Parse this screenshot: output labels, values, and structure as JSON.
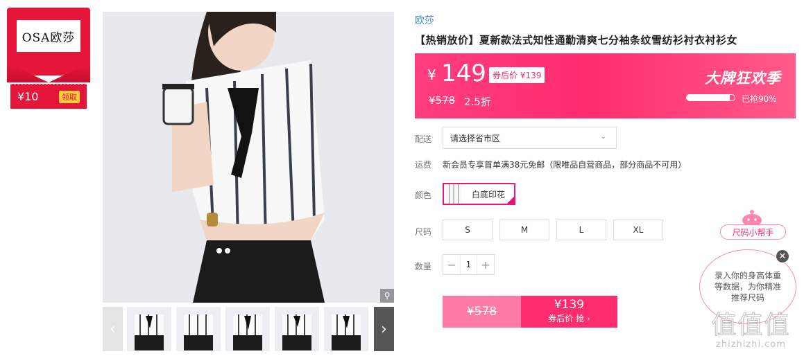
{
  "brand_card": {
    "logo_text": "OSA欧莎",
    "coupon_value": "¥10",
    "claim_label": "领取"
  },
  "product": {
    "brand": "欧莎",
    "title": "【热销放价】夏新款法式知性通勤清爽七分袖条纹雪纺衫衬衣衬衫女"
  },
  "price_banner": {
    "currency": "¥",
    "price": "149",
    "coupon_tag": "券后价 ¥139",
    "original_price": "¥578",
    "discount": "2.5折",
    "promo_title": "大牌狂欢季",
    "progress_text": "已抢90%",
    "progress_value": 0.9
  },
  "delivery": {
    "label": "配送",
    "placeholder": "请选择省市区"
  },
  "shipping": {
    "label": "运费",
    "text": "新会员专享首单满38元免邮（限唯品自营商品，部分商品不可用）"
  },
  "color": {
    "label": "颜色",
    "selected": "白底印花"
  },
  "size": {
    "label": "尺码",
    "options": [
      "S",
      "M",
      "L",
      "XL"
    ]
  },
  "quantity": {
    "label": "数量",
    "minus": "−",
    "value": "1",
    "plus": "+"
  },
  "buy": {
    "original": "¥578",
    "coupon_price": "¥139",
    "coupon_label": "券后价 抢 ›"
  },
  "size_helper": {
    "tag": "尺码小帮手",
    "message": "录入你的身高体重等数据，为你精准推荐尺码",
    "close": "✕"
  },
  "watermark": {
    "big": "值值值",
    "small": "zhizhizhi.com"
  },
  "icons": {
    "zoom": "search-icon",
    "prev": "chevron-left-icon",
    "next": "chevron-right-icon",
    "dropdown": "chevron-down-icon"
  },
  "colors": {
    "accent": "#ff2c6e",
    "brand_red": "#e6163b",
    "link": "#3c8ad8"
  }
}
